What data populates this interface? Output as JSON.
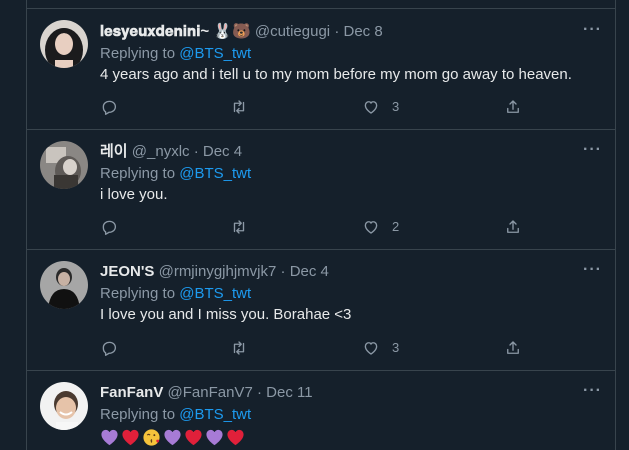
{
  "tweets": [
    {
      "display_name": "𝐥𝐞𝐬𝐲𝐞𝐮𝐱𝐝𝐞𝐧𝐢𝐧𝐢~ 🐰🐻",
      "handle": "@cutiegugi",
      "date": "Dec 8",
      "replying_prefix": "Replying to",
      "mention": "@BTS_twt",
      "text": "4 years ago and i tell u to my mom before my mom go away to heaven.",
      "likes": "3",
      "avatar_icon": "profile-photo-dark-hair"
    },
    {
      "display_name": "레이",
      "handle": "@_nyxlc",
      "date": "Dec 4",
      "replying_prefix": "Replying to",
      "mention": "@BTS_twt",
      "text": "i love you.",
      "likes": "2",
      "avatar_icon": "profile-photo-gray"
    },
    {
      "display_name": "JEON'S",
      "handle": "@rmjinygjhjmvjk7",
      "date": "Dec 4",
      "replying_prefix": "Replying to",
      "mention": "@BTS_twt",
      "text": "I love you and I miss you. Borahae <3",
      "likes": "3",
      "avatar_icon": "profile-photo-black-outfit"
    },
    {
      "display_name": "FanFanV",
      "handle": "@FanFanV7",
      "date": "Dec 11",
      "replying_prefix": "Replying to",
      "mention": "@BTS_twt",
      "emojis": [
        "purple-heart",
        "red-heart",
        "kissing-face",
        "purple-heart",
        "red-heart",
        "purple-heart",
        "red-heart"
      ],
      "avatar_icon": "profile-photo-smiling"
    }
  ],
  "ui": {
    "more_glyph": "···",
    "separator": "·"
  },
  "colors": {
    "background": "#15202b",
    "border": "#38444d",
    "text": "#e7e9ea",
    "muted": "#8b98a5",
    "link": "#1d9bf0",
    "purple_heart": "#a77bd6",
    "red_heart": "#e0203a"
  }
}
